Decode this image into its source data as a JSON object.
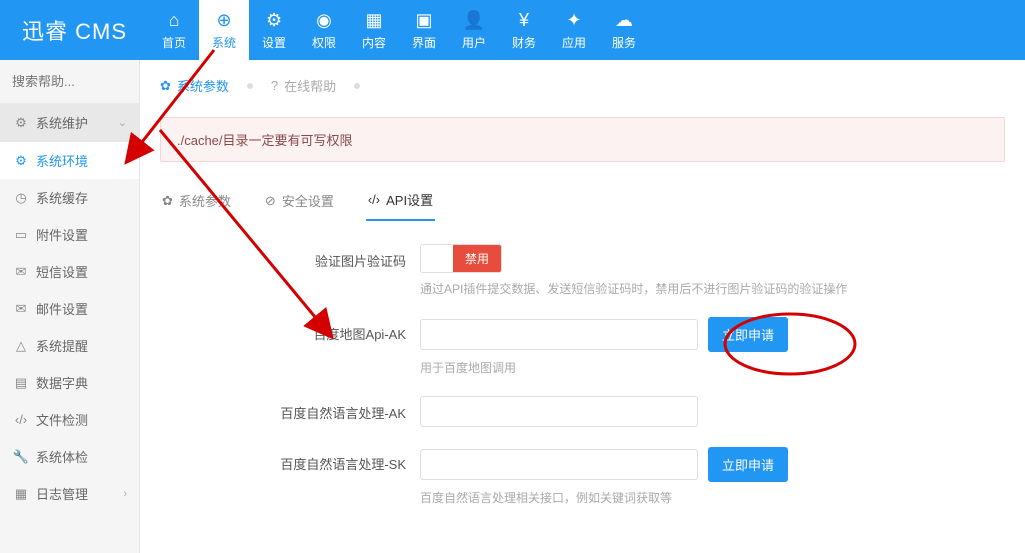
{
  "brand": "迅睿 CMS",
  "topnav": [
    {
      "icon": "home-icon",
      "glyph": "⌂",
      "label": "首页"
    },
    {
      "icon": "globe-icon",
      "glyph": "⊕",
      "label": "系统",
      "active": true
    },
    {
      "icon": "cogs-icon",
      "glyph": "⚙",
      "label": "设置"
    },
    {
      "icon": "user-circle-icon",
      "glyph": "◉",
      "label": "权限"
    },
    {
      "icon": "grid-icon",
      "glyph": "▦",
      "label": "内容"
    },
    {
      "icon": "layout-icon",
      "glyph": "▣",
      "label": "界面"
    },
    {
      "icon": "user-icon",
      "glyph": "👤",
      "label": "用户"
    },
    {
      "icon": "yen-icon",
      "glyph": "¥",
      "label": "财务"
    },
    {
      "icon": "puzzle-icon",
      "glyph": "✦",
      "label": "应用"
    },
    {
      "icon": "cloud-icon",
      "glyph": "☁",
      "label": "服务"
    }
  ],
  "search": {
    "placeholder": "搜索帮助..."
  },
  "side": {
    "head": {
      "icon": "gear-icon",
      "glyph": "⚙",
      "label": "系统维护"
    },
    "items": [
      {
        "icon": "gear-icon",
        "glyph": "⚙",
        "label": "系统环境",
        "active": true
      },
      {
        "icon": "clock-icon",
        "glyph": "◷",
        "label": "系统缓存"
      },
      {
        "icon": "folder-icon",
        "glyph": "▭",
        "label": "附件设置"
      },
      {
        "icon": "mail-icon",
        "glyph": "✉",
        "label": "短信设置"
      },
      {
        "icon": "envelope-icon",
        "glyph": "✉",
        "label": "邮件设置"
      },
      {
        "icon": "bell-icon",
        "glyph": "△",
        "label": "系统提醒"
      },
      {
        "icon": "book-icon",
        "glyph": "▤",
        "label": "数据字典"
      },
      {
        "icon": "code-icon",
        "glyph": "‹/›",
        "label": "文件检测"
      },
      {
        "icon": "wrench-icon",
        "glyph": "🔧",
        "label": "系统体检"
      },
      {
        "icon": "calendar-icon",
        "glyph": "▦",
        "label": "日志管理",
        "hasarrow": true
      }
    ]
  },
  "crumb": {
    "seg1": {
      "icon": "gear-icon",
      "glyph": "✿",
      "label": "系统参数"
    },
    "seg2": {
      "icon": "help-icon",
      "glyph": "?",
      "label": "在线帮助"
    }
  },
  "alert": "./cache/目录一定要有可写权限",
  "tabs": [
    {
      "icon": "gear-icon",
      "glyph": "✿",
      "label": "系统参数"
    },
    {
      "icon": "shield-icon",
      "glyph": "⊘",
      "label": "安全设置"
    },
    {
      "icon": "code-icon",
      "glyph": "‹/›",
      "label": "API设置",
      "active": true
    }
  ],
  "form": {
    "row1": {
      "label": "验证图片验证码",
      "toggle_off": "禁用",
      "help": "通过API插件提交数据、发送短信验证码时，禁用后不进行图片验证码的验证操作"
    },
    "row2": {
      "label": "百度地图Api-AK",
      "btn": "立即申请",
      "help": "用于百度地图调用"
    },
    "row3": {
      "label": "百度自然语言处理-AK"
    },
    "row4": {
      "label": "百度自然语言处理-SK",
      "btn": "立即申请",
      "help": "百度自然语言处理相关接口，例如关键词获取等"
    }
  }
}
